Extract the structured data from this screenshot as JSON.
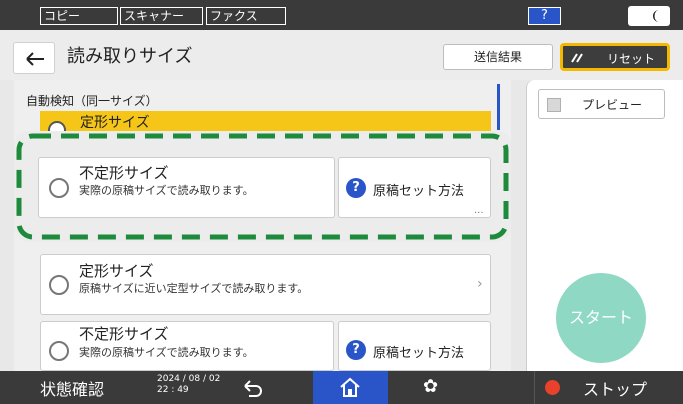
{
  "tabs": [
    {
      "label": "コピー"
    },
    {
      "label": "スキャナー"
    },
    {
      "label": "ファクス"
    }
  ],
  "help_label": "?",
  "header": {
    "title": "読み取りサイズ",
    "result_label": "送信結果",
    "reset_label": "リセット"
  },
  "section_label": "自動検知（同一サイズ）",
  "selected_label": "定形サイズ",
  "options": [
    {
      "title": "不定形サイズ",
      "subtitle": "実際の原稿サイズで読み取ります。",
      "link": "原稿セット方法",
      "more": "..."
    },
    {
      "title": "定形サイズ",
      "subtitle": "原稿サイズに近い定型サイズで読み取ります。",
      "chevron": "›"
    },
    {
      "title": "不定形サイズ",
      "subtitle": "実際の原稿サイズで読み取ります。",
      "link": "原稿セット方法"
    }
  ],
  "preview_label": "プレビュー",
  "start_label": "スタート",
  "bottom": {
    "status_label": "状態確認",
    "date": "2024 / 08 / 02",
    "time": "22 : 49",
    "gear_glyph": "✿",
    "stop_label": "ストップ"
  },
  "colors": {
    "accent_blue": "#2a55c8",
    "highlight_yellow": "#f5c518",
    "dash_green": "#1e8a3c",
    "start_green": "#8fd8c4"
  }
}
